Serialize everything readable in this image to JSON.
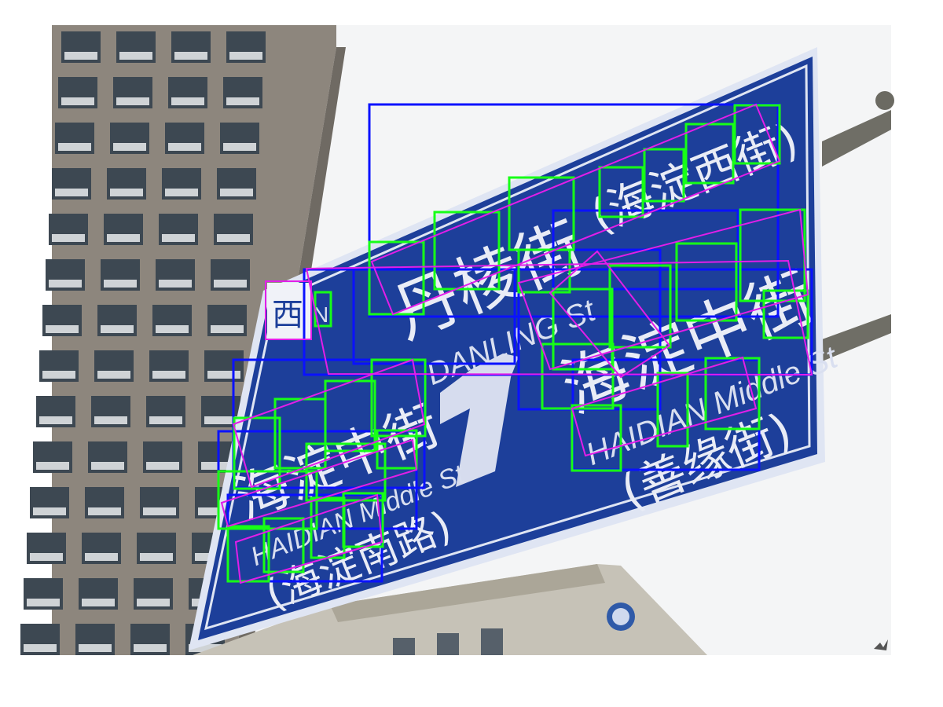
{
  "image": {
    "description_colors": {
      "sky": "#f4f5f6",
      "building_left": "#8d867d",
      "building_window": "#3d4852",
      "sign_blue": "#1d3f9a",
      "sign_border": "#dfe5f3",
      "pole": "#6f6e66",
      "box_word": "#0a12ff",
      "box_char": "#17ff17",
      "box_rotated": "#e21ee8"
    }
  },
  "sign": {
    "north_char": "西",
    "north_letter": "N",
    "top_cn": "丹棱街",
    "top_cn_paren": "(海淀西街)",
    "top_en": "DANLING St",
    "right_cn": "海淀中街",
    "right_en": "HAIDIAN Middle St",
    "right_sub": "(善缘街)",
    "left_cn": "海淀中街",
    "left_en": "HAIDIAN Middle St",
    "left_sub": "(海淀南路)"
  }
}
